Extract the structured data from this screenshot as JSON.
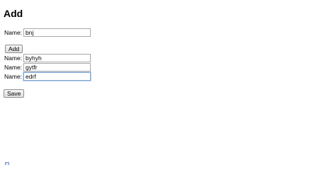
{
  "page": {
    "title": "Add"
  },
  "new_entry": {
    "label": "Name:",
    "value": "bnj"
  },
  "add_button": {
    "label": "Add"
  },
  "entries": [
    {
      "label": "Name:",
      "value": "byhyh"
    },
    {
      "label": "Name:",
      "value": "gytfr"
    },
    {
      "label": "Name:",
      "value": "edrf"
    }
  ],
  "save_button": {
    "label": "Save"
  },
  "status_icon": {
    "name": "page-icon"
  }
}
